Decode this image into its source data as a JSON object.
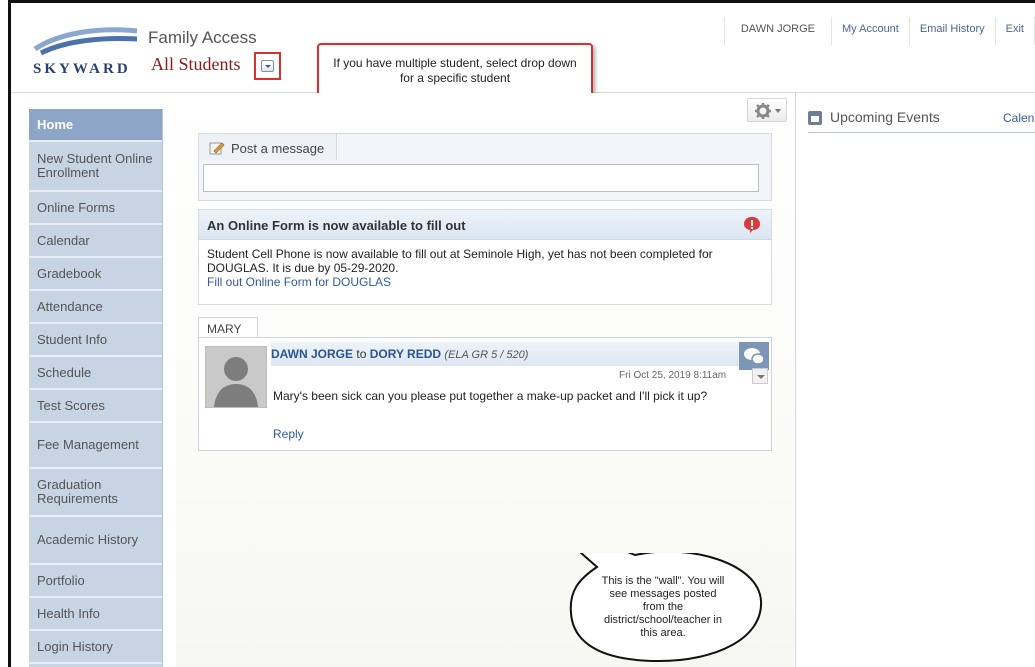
{
  "header": {
    "logo_text": "SKYWARD",
    "app_title": "Family Access",
    "student_select": "All Students",
    "callout": "If you have multiple student, select drop down for a specific student"
  },
  "topnav": {
    "user": "DAWN JORGE",
    "items": [
      "My Account",
      "Email History",
      "Exit"
    ]
  },
  "sidebar": {
    "items": [
      {
        "label": "Home",
        "active": true
      },
      {
        "label": "New Student Online Enrollment"
      },
      {
        "label": "Online Forms"
      },
      {
        "label": "Calendar"
      },
      {
        "label": "Gradebook"
      },
      {
        "label": "Attendance"
      },
      {
        "label": "Student Info"
      },
      {
        "label": "Schedule"
      },
      {
        "label": "Test Scores"
      },
      {
        "label": "Fee Management"
      },
      {
        "label": "Graduation Requirements"
      },
      {
        "label": "Academic History"
      },
      {
        "label": "Portfolio"
      },
      {
        "label": "Health Info"
      },
      {
        "label": "Login History"
      }
    ]
  },
  "post": {
    "tab_label": "Post a message",
    "input_value": ""
  },
  "online_form": {
    "title": "An Online Form is now available to fill out",
    "body": "Student Cell Phone is now available to fill out at Seminole High, yet has not been completed for DOUGLAS.  It is due by 05-29-2020.",
    "link": "Fill out Online Form for DOUGLAS"
  },
  "message": {
    "tab": "MARY",
    "from": "DAWN JORGE",
    "to_word": "to",
    "to": "DORY REDD",
    "course": "(ELA GR 5 / 520)",
    "date": "Fri Oct 25, 2019 8:11am",
    "text": "Mary's been sick can you please put together a make-up packet and I'll pick it up?",
    "reply": "Reply"
  },
  "wall_callout": "This is the \"wall\".  You will see messages posted from the district/school/teacher in this area.",
  "right": {
    "events_title": "Upcoming Events",
    "calendar_link": "Calendar"
  },
  "colors": {
    "accent": "#8b1a1a",
    "sidebar": "#c7d4e3",
    "sidebar_active": "#8da5c7",
    "link": "#2f5c9a",
    "callout_border": "#d9302c"
  }
}
